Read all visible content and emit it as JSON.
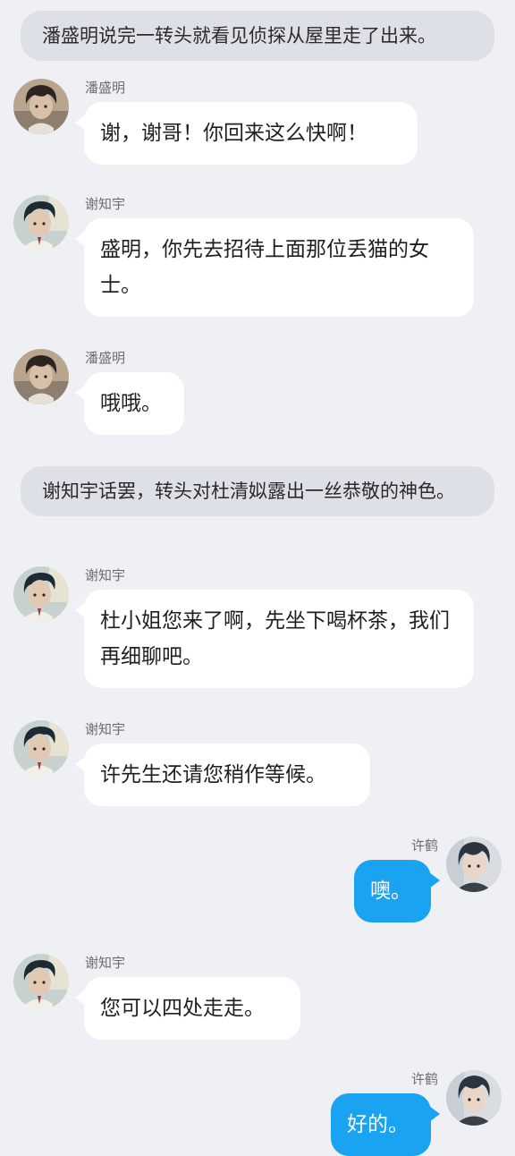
{
  "narrations": [
    "潘盛明说完一转头就看见侦探从屋里走了出来。",
    "谢知宇话罢，转头对杜清姒露出一丝恭敬的神色。"
  ],
  "messages": [
    {
      "sender": "潘盛明",
      "text": "谢，谢哥！你回来这么快啊！",
      "side": "left",
      "avatar": "pan-avatar"
    },
    {
      "sender": "谢知宇",
      "text": "盛明，你先去招待上面那位丢猫的女士。",
      "side": "left",
      "avatar": "xie-avatar"
    },
    {
      "sender": "潘盛明",
      "text": "哦哦。",
      "side": "left",
      "avatar": "pan-avatar"
    },
    {
      "sender": "谢知宇",
      "text": "杜小姐您来了啊，先坐下喝杯茶，我们再细聊吧。",
      "side": "left",
      "avatar": "xie-avatar"
    },
    {
      "sender": "谢知宇",
      "text": "许先生还请您稍作等候。",
      "side": "left",
      "avatar": "xie-avatar"
    },
    {
      "sender": "许鹤",
      "text": "噢。",
      "side": "right",
      "avatar": "xu-avatar"
    },
    {
      "sender": "谢知宇",
      "text": "您可以四处走走。",
      "side": "left",
      "avatar": "xie-avatar"
    },
    {
      "sender": "许鹤",
      "text": "好的。",
      "side": "right",
      "avatar": "xu-avatar"
    }
  ],
  "colors": {
    "background": "#eef0f4",
    "narration_bg": "#dde0e6",
    "left_bubble": "#ffffff",
    "right_bubble": "#1aa3f0",
    "sender_name": "#6b6e75"
  }
}
